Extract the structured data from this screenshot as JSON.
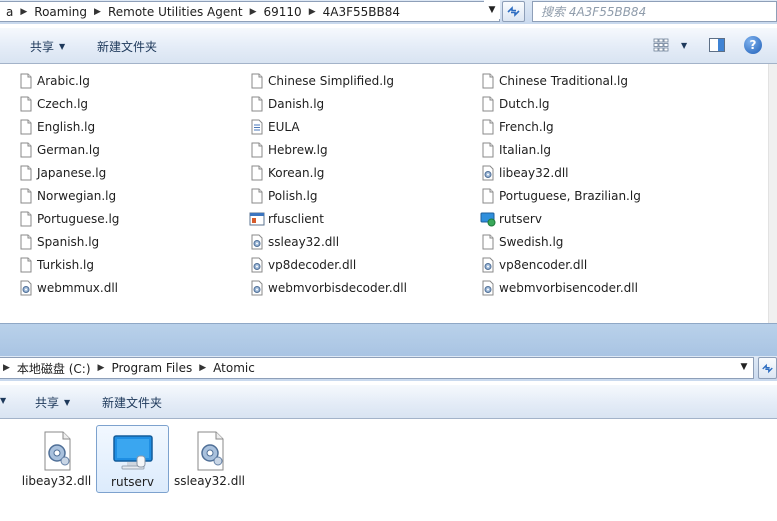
{
  "top_window": {
    "breadcrumb": [
      "a",
      "Roaming",
      "Remote Utilities Agent",
      "69110",
      "4A3F55BB84"
    ],
    "search_placeholder": "搜索 4A3F55BB84",
    "toolbar": {
      "share_label": "共享",
      "new_folder_label": "新建文件夹"
    },
    "files": [
      {
        "name": "Arabic.lg",
        "icon": "document-icon"
      },
      {
        "name": "Chinese Simplified.lg",
        "icon": "document-icon"
      },
      {
        "name": "Chinese Traditional.lg",
        "icon": "document-icon"
      },
      {
        "name": "Czech.lg",
        "icon": "document-icon"
      },
      {
        "name": "Danish.lg",
        "icon": "document-icon"
      },
      {
        "name": "Dutch.lg",
        "icon": "document-icon"
      },
      {
        "name": "English.lg",
        "icon": "document-icon"
      },
      {
        "name": "EULA",
        "icon": "text-file-icon"
      },
      {
        "name": "French.lg",
        "icon": "document-icon"
      },
      {
        "name": "German.lg",
        "icon": "document-icon"
      },
      {
        "name": "Hebrew.lg",
        "icon": "document-icon"
      },
      {
        "name": "Italian.lg",
        "icon": "document-icon"
      },
      {
        "name": "Japanese.lg",
        "icon": "document-icon"
      },
      {
        "name": "Korean.lg",
        "icon": "document-icon"
      },
      {
        "name": "libeay32.dll",
        "icon": "dll-icon"
      },
      {
        "name": "Norwegian.lg",
        "icon": "document-icon"
      },
      {
        "name": "Polish.lg",
        "icon": "document-icon"
      },
      {
        "name": "Portuguese, Brazilian.lg",
        "icon": "document-icon"
      },
      {
        "name": "Portuguese.lg",
        "icon": "document-icon"
      },
      {
        "name": "rfusclient",
        "icon": "app-window-icon"
      },
      {
        "name": "rutserv",
        "icon": "remote-app-icon"
      },
      {
        "name": "Spanish.lg",
        "icon": "document-icon"
      },
      {
        "name": "ssleay32.dll",
        "icon": "dll-icon"
      },
      {
        "name": "Swedish.lg",
        "icon": "document-icon"
      },
      {
        "name": "Turkish.lg",
        "icon": "document-icon"
      },
      {
        "name": "vp8decoder.dll",
        "icon": "dll-icon"
      },
      {
        "name": "vp8encoder.dll",
        "icon": "dll-icon"
      },
      {
        "name": "webmmux.dll",
        "icon": "dll-icon"
      },
      {
        "name": "webmvorbisdecoder.dll",
        "icon": "dll-icon"
      },
      {
        "name": "webmvorbisencoder.dll",
        "icon": "dll-icon"
      }
    ]
  },
  "bottom_window": {
    "breadcrumb": [
      "本地磁盘 (C:)",
      "Program Files",
      "Atomic"
    ],
    "toolbar": {
      "share_label": "共享",
      "new_folder_label": "新建文件夹"
    },
    "files": [
      {
        "name": "libeay32.dll",
        "icon": "dll-icon",
        "selected": false
      },
      {
        "name": "rutserv",
        "icon": "monitor-icon",
        "selected": true
      },
      {
        "name": "ssleay32.dll",
        "icon": "dll-icon",
        "selected": false
      }
    ]
  },
  "colors": {
    "toolbar_text": "#1e395b",
    "selection_border": "#7da2ce",
    "window_frame": "#b9d1ea"
  }
}
